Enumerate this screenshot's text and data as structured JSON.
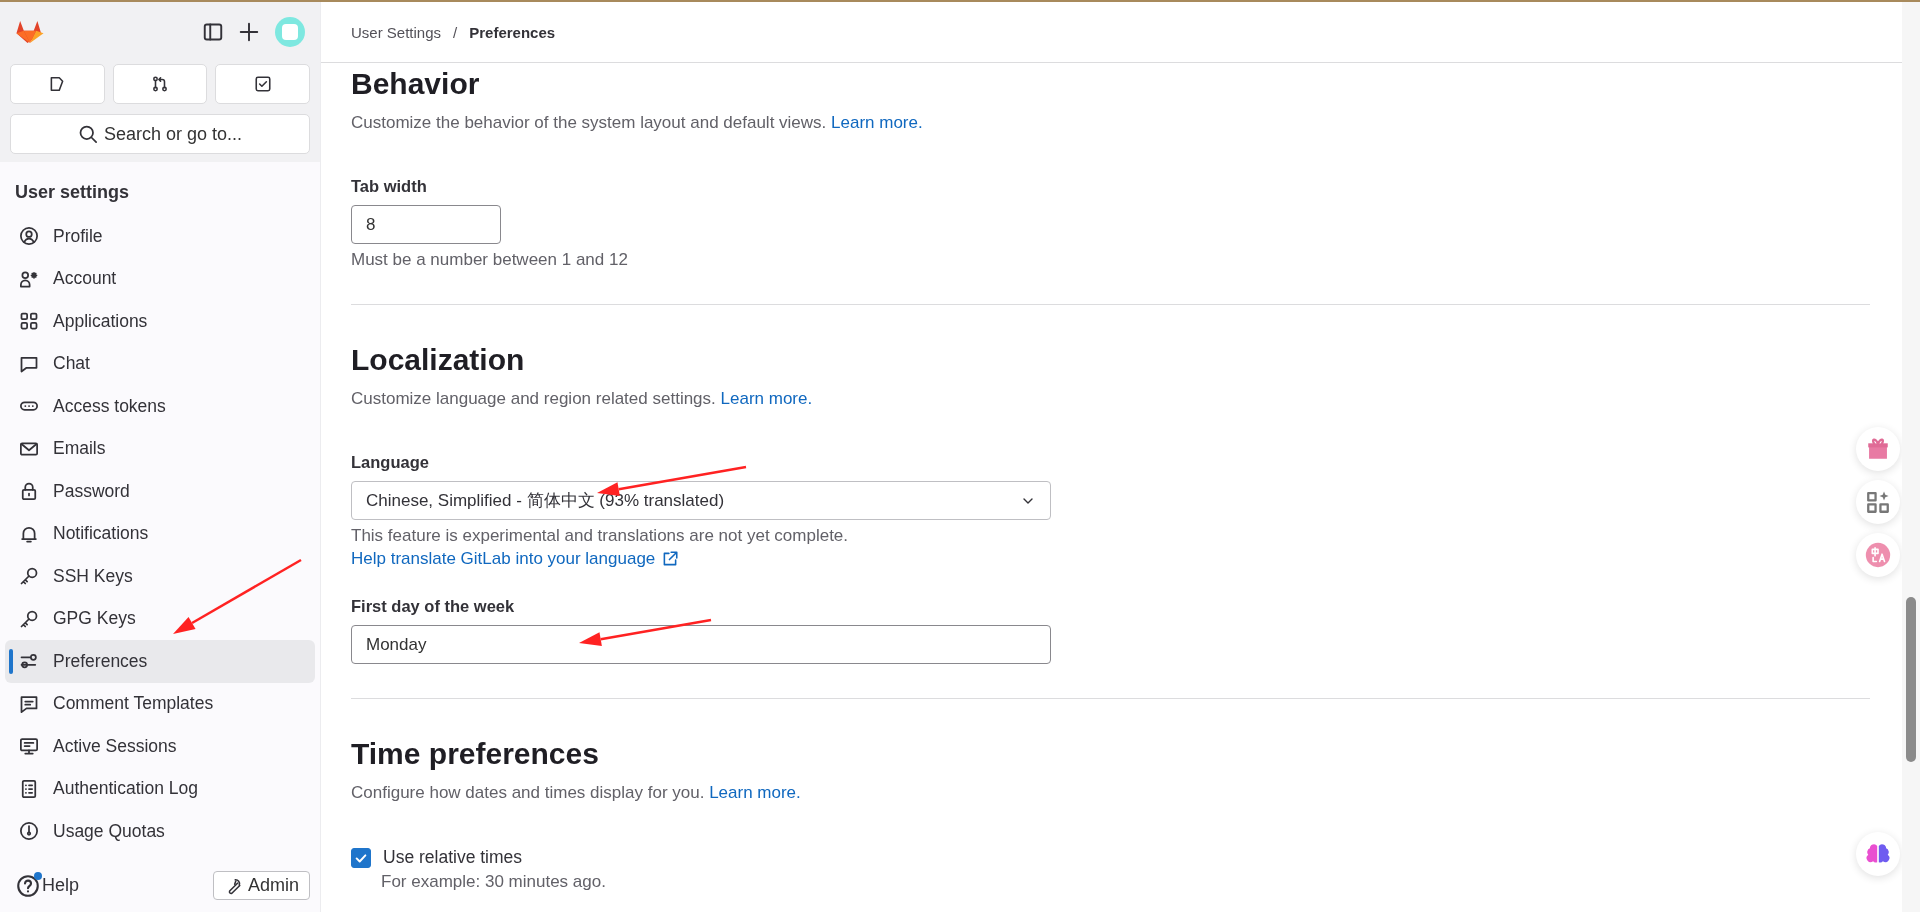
{
  "sidebar": {
    "search": {
      "placeholder": "Search or go to..."
    },
    "section_title": "User settings",
    "items": [
      {
        "label": "Profile",
        "selected": false
      },
      {
        "label": "Account",
        "selected": false
      },
      {
        "label": "Applications",
        "selected": false
      },
      {
        "label": "Chat",
        "selected": false
      },
      {
        "label": "Access tokens",
        "selected": false
      },
      {
        "label": "Emails",
        "selected": false
      },
      {
        "label": "Password",
        "selected": false
      },
      {
        "label": "Notifications",
        "selected": false
      },
      {
        "label": "SSH Keys",
        "selected": false
      },
      {
        "label": "GPG Keys",
        "selected": false
      },
      {
        "label": "Preferences",
        "selected": true
      },
      {
        "label": "Comment Templates",
        "selected": false
      },
      {
        "label": "Active Sessions",
        "selected": false
      },
      {
        "label": "Authentication Log",
        "selected": false
      },
      {
        "label": "Usage Quotas",
        "selected": false
      }
    ],
    "help": {
      "label": "Help",
      "badge": true
    },
    "admin": "Admin"
  },
  "breadcrumb": [
    {
      "label": "User Settings",
      "current": false
    },
    {
      "label": "Preferences",
      "current": true
    }
  ],
  "breadcrumb_separator": "/",
  "sections": [
    {
      "title": "Behavior",
      "description": "Customize the behavior of the system layout and default views.",
      "link": "Learn more.",
      "fields": [
        {
          "kind": "number",
          "label": "Tab width",
          "value": "8",
          "hint": "Must be a number between 1 and 12"
        }
      ]
    },
    {
      "title": "Localization",
      "description": "Customize language and region related settings.",
      "link": "Learn more.",
      "fields": [
        {
          "kind": "select",
          "label": "Language",
          "value": "Chinese, Simplified - 简体中文 (93% translated)",
          "hint": "This feature is experimental and translations are not yet complete.",
          "help_link": "Help translate GitLab into your language"
        },
        {
          "kind": "text",
          "label": "First day of the week",
          "value": "Monday"
        }
      ]
    },
    {
      "title": "Time preferences",
      "description": "Configure how dates and times display for you.",
      "link": "Learn more.",
      "fields": [
        {
          "kind": "checkbox",
          "label": "Use relative times",
          "checked": true,
          "hint": "For example: 30 minutes ago."
        }
      ]
    }
  ]
}
